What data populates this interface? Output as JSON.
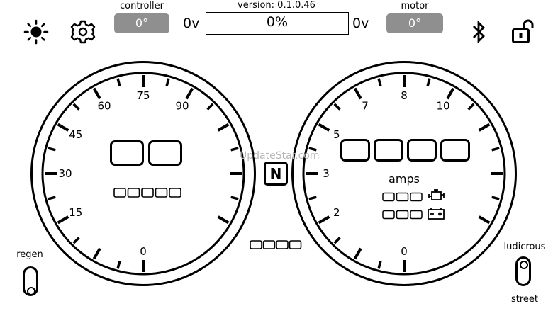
{
  "top": {
    "controller_label": "controller",
    "controller_value": "0°",
    "left_voltage": "0v",
    "version_label": "version: 0.1.0.46",
    "progress_text": "0%",
    "right_voltage": "0v",
    "motor_label": "motor",
    "motor_value": "0°"
  },
  "icons": {
    "brightness": "brightness-icon",
    "settings": "gear-icon",
    "bluetooth": "bluetooth-icon",
    "lock": "unlock-icon"
  },
  "speed_gauge": {
    "tick_labels": [
      "0",
      "15",
      "30",
      "45",
      "60",
      "75",
      "90"
    ]
  },
  "amps_gauge": {
    "unit_label": "amps",
    "tick_labels": [
      "0",
      "2",
      "3",
      "5",
      "7",
      "8",
      "10"
    ]
  },
  "gear": "N",
  "regen": {
    "label": "regen"
  },
  "mode": {
    "top_label": "ludicrous",
    "bottom_label": "street"
  },
  "watermark": "UpdateStar.com"
}
